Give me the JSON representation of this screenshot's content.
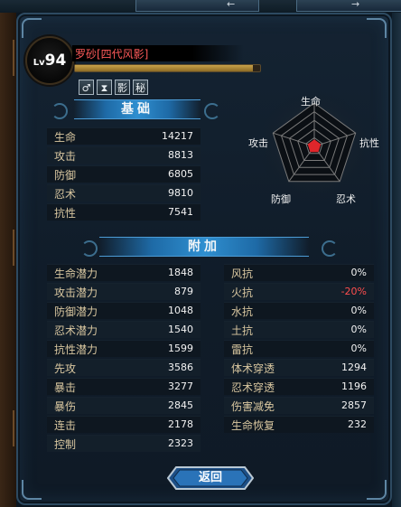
{
  "top": {
    "left_glyph": "←",
    "right_glyph": "→"
  },
  "character": {
    "level_prefix": "Lv",
    "level": "94",
    "name": "罗砂[四代风影]",
    "exp_fraction": 0.96
  },
  "status_icons": [
    {
      "name": "male-gender-icon",
      "glyph": "♂"
    },
    {
      "name": "hourglass-icon",
      "glyph": "⧗"
    },
    {
      "name": "shadow-glyph-icon",
      "glyph": "影"
    },
    {
      "name": "secret-glyph-icon",
      "glyph": "秘"
    }
  ],
  "basic": {
    "title": "基础",
    "rows": [
      {
        "label": "生命",
        "value": "14217"
      },
      {
        "label": "攻击",
        "value": "8813"
      },
      {
        "label": "防御",
        "value": "6805"
      },
      {
        "label": "忍术",
        "value": "9810"
      },
      {
        "label": "抗性",
        "value": "7541"
      }
    ]
  },
  "radar": {
    "labels": {
      "top": "生命",
      "right": "抗性",
      "bottom_right": "忍术",
      "bottom_left": "防御",
      "left": "攻击"
    },
    "grid_color": "#7a7a7a",
    "fill_color": "#e0262b"
  },
  "extra": {
    "title": "附加",
    "left_rows": [
      {
        "label": "生命潜力",
        "value": "1848"
      },
      {
        "label": "攻击潜力",
        "value": "879"
      },
      {
        "label": "防御潜力",
        "value": "1048"
      },
      {
        "label": "忍术潜力",
        "value": "1540"
      },
      {
        "label": "抗性潜力",
        "value": "1599"
      },
      {
        "label": "先攻",
        "value": "3586"
      },
      {
        "label": "暴击",
        "value": "3277"
      },
      {
        "label": "暴伤",
        "value": "2845"
      },
      {
        "label": "连击",
        "value": "2178"
      },
      {
        "label": "控制",
        "value": "2323"
      }
    ],
    "right_rows": [
      {
        "label": "风抗",
        "value": "0%"
      },
      {
        "label": "火抗",
        "value": "-20%",
        "negative": true
      },
      {
        "label": "水抗",
        "value": "0%"
      },
      {
        "label": "土抗",
        "value": "0%"
      },
      {
        "label": "雷抗",
        "value": "0%"
      },
      {
        "label": "体术穿透",
        "value": "1294"
      },
      {
        "label": "忍术穿透",
        "value": "1196"
      },
      {
        "label": "伤害减免",
        "value": "2857"
      },
      {
        "label": "生命恢复",
        "value": "232"
      }
    ]
  },
  "return_button": {
    "label": "返回"
  }
}
